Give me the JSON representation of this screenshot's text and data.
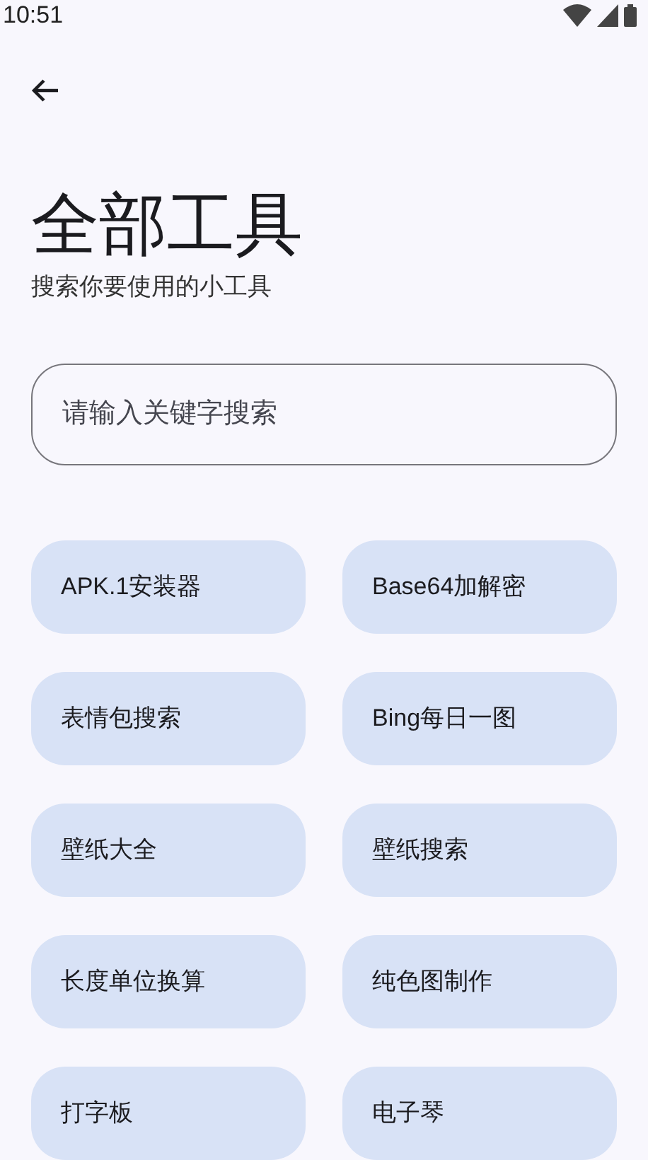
{
  "status_bar": {
    "time": "10:51"
  },
  "header": {
    "title": "全部工具",
    "subtitle": "搜索你要使用的小工具"
  },
  "search": {
    "placeholder": "请输入关键字搜索"
  },
  "tools": [
    {
      "label": "APK.1安装器"
    },
    {
      "label": "Base64加解密"
    },
    {
      "label": "表情包搜索"
    },
    {
      "label": "Bing每日一图"
    },
    {
      "label": "壁纸大全"
    },
    {
      "label": "壁纸搜索"
    },
    {
      "label": "长度单位换算"
    },
    {
      "label": "纯色图制作"
    },
    {
      "label": "打字板"
    },
    {
      "label": "电子琴"
    }
  ]
}
